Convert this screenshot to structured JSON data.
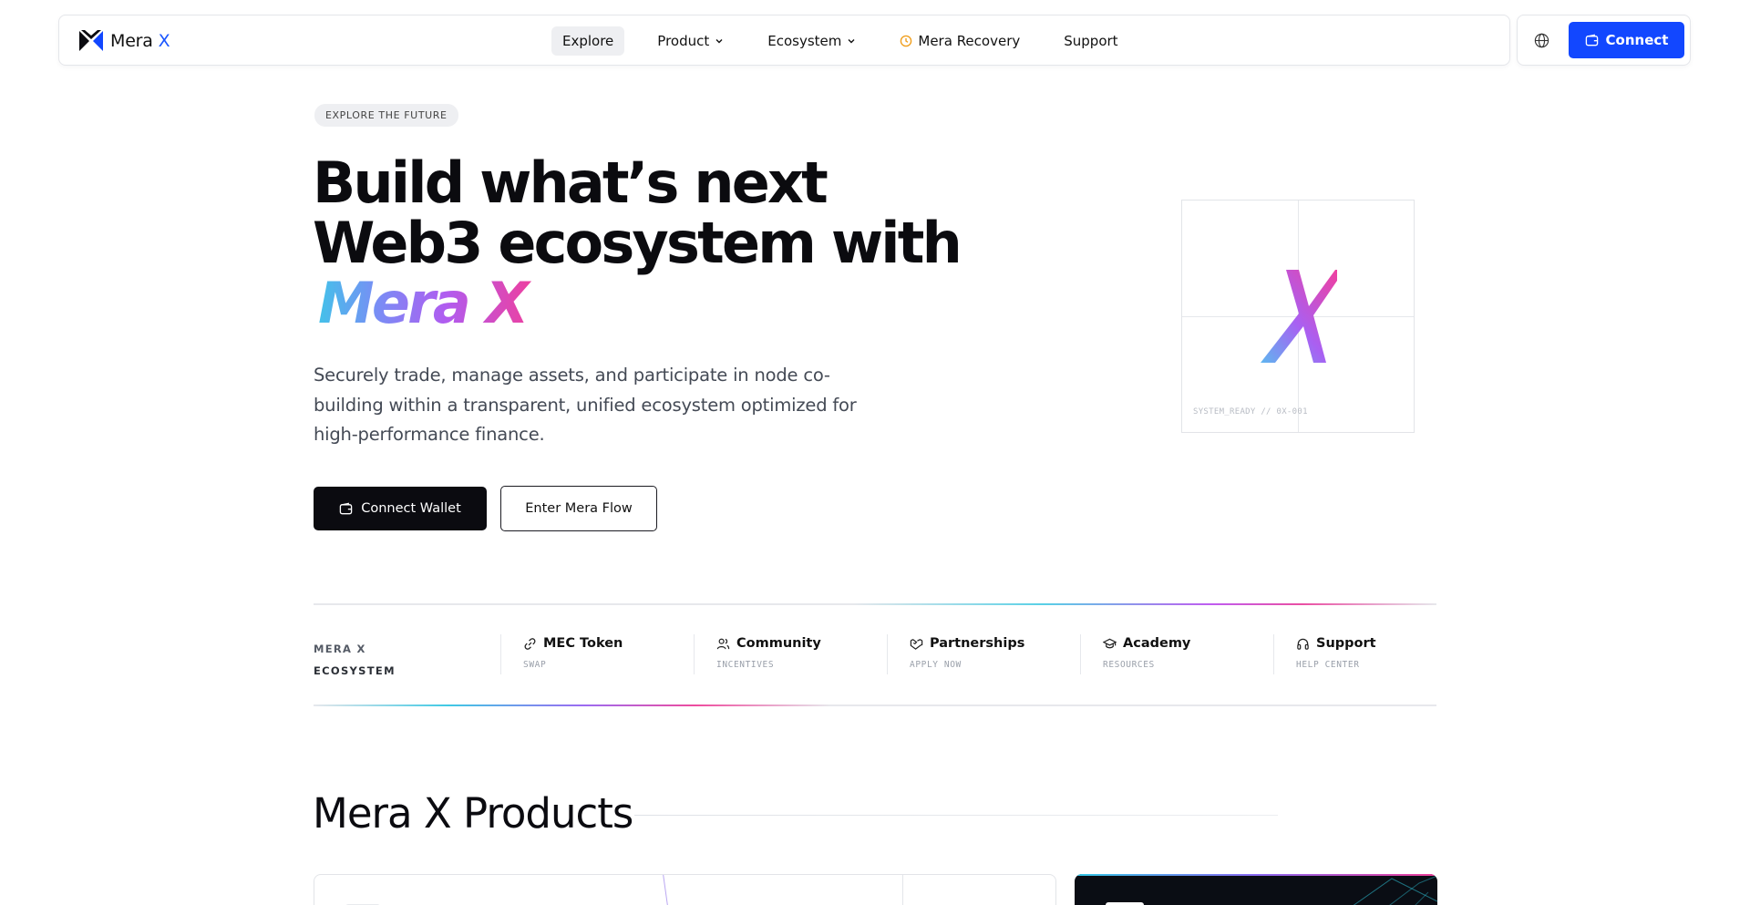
{
  "brand": {
    "name": "Mera",
    "name_suffix": "X",
    "accent": "#1247ff"
  },
  "nav": {
    "items": [
      {
        "label": "Explore",
        "active": true,
        "has_dropdown": false
      },
      {
        "label": "Product",
        "active": false,
        "has_dropdown": true
      },
      {
        "label": "Ecosystem",
        "active": false,
        "has_dropdown": true
      },
      {
        "label": "Mera Recovery",
        "active": false,
        "has_dropdown": false,
        "icon": "clock-icon"
      },
      {
        "label": "Support",
        "active": false,
        "has_dropdown": false
      }
    ],
    "connect_label": "Connect"
  },
  "hero": {
    "eyebrow": "EXPLORE THE FUTURE",
    "headline_line1": "Build what’s next",
    "headline_line2": "Web3 ecosystem with",
    "headline_brand": "Mera X",
    "lead": "Securely trade, manage assets, and participate in node co-building within a transparent, unified ecosystem optimized for high-performance finance.",
    "primary_button": "Connect Wallet",
    "secondary_button": "Enter Mera Flow",
    "visual_caption": "SYSTEM_READY // 0X-001",
    "visual_glyph": "X"
  },
  "ecosystem": {
    "label_line1": "MERA X",
    "label_line2": "ECOSYSTEM",
    "items": [
      {
        "title": "MEC Token",
        "subtitle": "SWAP",
        "icon": "link-icon"
      },
      {
        "title": "Community",
        "subtitle": "INCENTIVES",
        "icon": "users-icon"
      },
      {
        "title": "Partnerships",
        "subtitle": "APPLY NOW",
        "icon": "handshake-icon"
      },
      {
        "title": "Academy",
        "subtitle": "RESOURCES",
        "icon": "graduation-cap-icon"
      },
      {
        "title": "Support",
        "subtitle": "HELP CENTER",
        "icon": "headphones-icon"
      }
    ]
  },
  "products": {
    "title": "Mera X Products"
  }
}
